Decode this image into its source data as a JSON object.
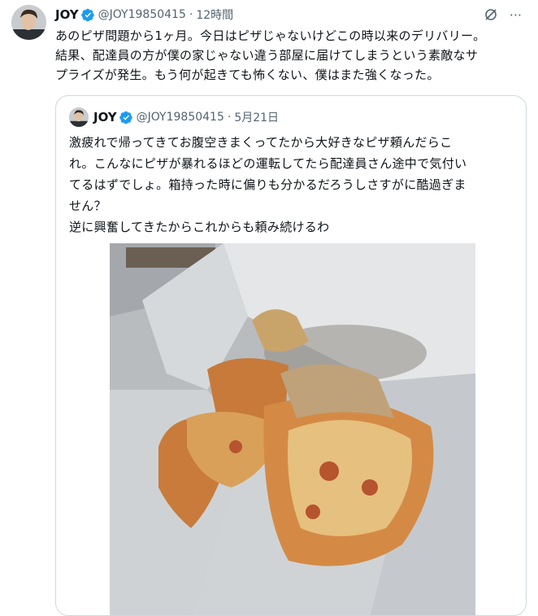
{
  "tweet": {
    "author_name": "JOY",
    "handle": "@JOY19850415",
    "separator": "·",
    "time": "12時間",
    "text": "あのピザ問題から1ヶ月。今日はピザじゃないけどこの時以来のデリバリー。\n結果、配達員の方が僕の家じゃない違う部屋に届けてしまうという素敵なサ\nプライズが発生。もう何が起きても怖くない、僕はまた強くなった。",
    "icons": {
      "verified": "verified-badge-icon",
      "grok": "grok-icon",
      "more": "more-icon"
    },
    "more_glyph": "···"
  },
  "quoted": {
    "author_name": "JOY",
    "handle": "@JOY19850415",
    "separator": "·",
    "date": "5月21日",
    "text": "激疲れで帰ってきてお腹空きまくってたから大好きなピザ頼んだらこ\nれ。こんなにピザが暴れるほどの運転してたら配達員さん途中で気付い\nてるはずでしょ。箱持った時に偏りも分かるだろうしさすがに酷過ぎま\nせん？\n逆に興奮してきたからこれからも頼み続けるわ"
  },
  "colors": {
    "accent": "#1d9bf0",
    "secondary_text": "#536471",
    "border": "#cfd9de"
  }
}
